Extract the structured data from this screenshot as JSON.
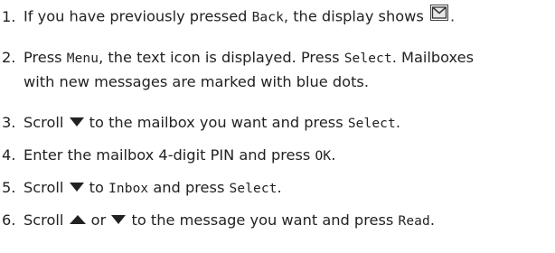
{
  "steps": [
    {
      "number": "1.",
      "parts": [
        "If you have previously pressed ",
        "Back",
        ", the display shows ",
        "."
      ]
    },
    {
      "number": "2.",
      "parts": [
        "Press ",
        "Menu",
        ", the text icon is displayed. Press ",
        "Select",
        ". Mailboxes",
        "with new messages are marked with blue dots."
      ]
    },
    {
      "number": "3.",
      "parts": [
        "Scroll ",
        " to the mailbox you want and press ",
        "Select",
        "."
      ]
    },
    {
      "number": "4.",
      "parts": [
        "Enter the mailbox 4-digit PIN and press ",
        "OK",
        "."
      ]
    },
    {
      "number": "5.",
      "parts": [
        "Scroll ",
        " to ",
        "Inbox",
        " and press ",
        "Select",
        "."
      ]
    },
    {
      "number": "6.",
      "parts": [
        "Scroll ",
        " or ",
        " to the message you want and press ",
        "Read",
        "."
      ]
    }
  ],
  "icons": {
    "envelope": "envelope-icon",
    "down": "triangle-down-icon",
    "up": "triangle-up-icon"
  },
  "colors": {
    "text": "#222222",
    "icon_frame": "#444444"
  }
}
